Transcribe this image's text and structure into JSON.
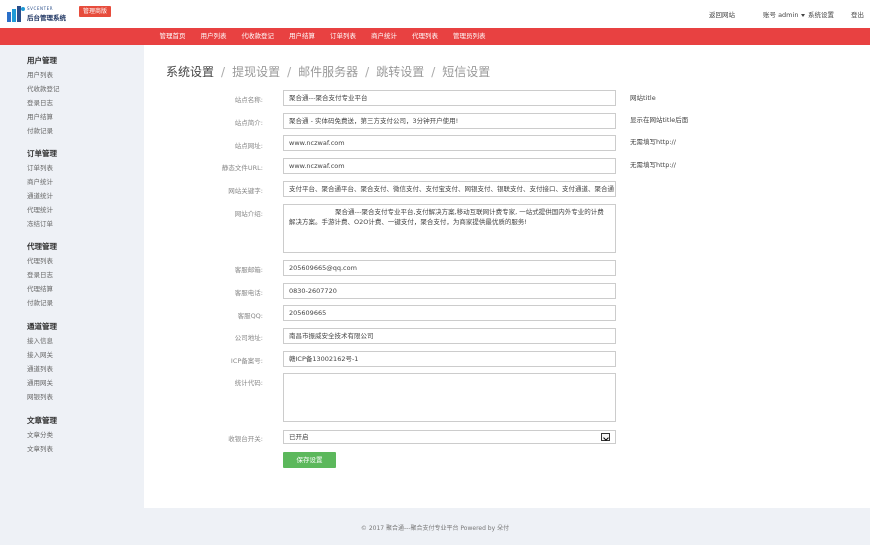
{
  "header": {
    "logo_small": "SVCENTER",
    "logo_title": "后台管理系统",
    "version_badge": "管理商版",
    "back_link": "返回网站",
    "account_label": "账号 admin",
    "system_settings": "系统设置",
    "logout": "登出",
    "colors": {
      "brand_red": "#e84141",
      "logo_blue": "#1f3562"
    }
  },
  "nav": {
    "items": [
      "管理首页",
      "用户列表",
      "代收款登记",
      "用户结算",
      "订单列表",
      "商户统计",
      "代理列表",
      "管理员列表"
    ]
  },
  "sidebar": {
    "groups": [
      {
        "title": "用户管理",
        "items": [
          "用户列表",
          "代收款登记",
          "登录日志",
          "用户结算",
          "付款记录"
        ]
      },
      {
        "title": "订单管理",
        "items": [
          "订单列表",
          "商户统计",
          "通道统计",
          "代理统计",
          "冻结订单"
        ]
      },
      {
        "title": "代理管理",
        "items": [
          "代理列表",
          "登录日志",
          "代理结算",
          "付款记录"
        ]
      },
      {
        "title": "通道管理",
        "items": [
          "接入信息",
          "接入网关",
          "通道列表",
          "通用网关",
          "网银列表"
        ]
      },
      {
        "title": "文章管理",
        "items": [
          "文章分类",
          "文章列表"
        ]
      }
    ]
  },
  "breadcrumb": {
    "items": [
      "系统设置",
      "提现设置",
      "邮件服务器",
      "跳转设置",
      "短信设置"
    ],
    "separator": "/"
  },
  "form": {
    "site_name": {
      "label": "站点名称:",
      "value": "聚合通---聚合支付专业平台",
      "hint": "网站title"
    },
    "site_intro": {
      "label": "站点简介:",
      "value": "聚合通 - 实体码免费送，第三方支付公司，3分钟开户使用!",
      "hint": "显示在网站title后面"
    },
    "site_url": {
      "label": "站点网址:",
      "value": "www.nczwaf.com",
      "hint": "无需填写http://"
    },
    "static_url": {
      "label": "静态文件URL:",
      "value": "www.nczwaf.com",
      "hint": "无需填写http://"
    },
    "keywords": {
      "label": "网站关键字:",
      "value": "支付平台、聚合通平台、聚合支付、微信支付、支付宝支付、网银支付、银联支付、支付接口、支付通道、聚合通"
    },
    "description": {
      "label": "网站介绍:",
      "value": "聚合通---聚合支付专业平台,支付解决方案,移动互联网计费专家, 一站式提供国内外专业的计费解决方案。手游计费、O2O计费、一键支付，聚合支付，为商家提供最优质的服务!"
    },
    "email": {
      "label": "客服邮箱:",
      "value": "205609665@qq.com"
    },
    "phone": {
      "label": "客服电话:",
      "value": "0830-2607720"
    },
    "qq": {
      "label": "客服QQ:",
      "value": "205609665"
    },
    "address": {
      "label": "公司地址:",
      "value": "南昌市振威安全技术有限公司"
    },
    "icp": {
      "label": "ICP备案号:",
      "value": "赣ICP备13002162号-1"
    },
    "stats_code": {
      "label": "统计代码:",
      "value": ""
    },
    "cashier_switch": {
      "label": "收银台开关:",
      "value": "已开启"
    },
    "save_label": "保存设置",
    "colors": {
      "save_green": "#5cb85c"
    }
  },
  "footer": {
    "text": "© 2017  聚合通---聚合支付专业平台 Powered by 朵付"
  }
}
